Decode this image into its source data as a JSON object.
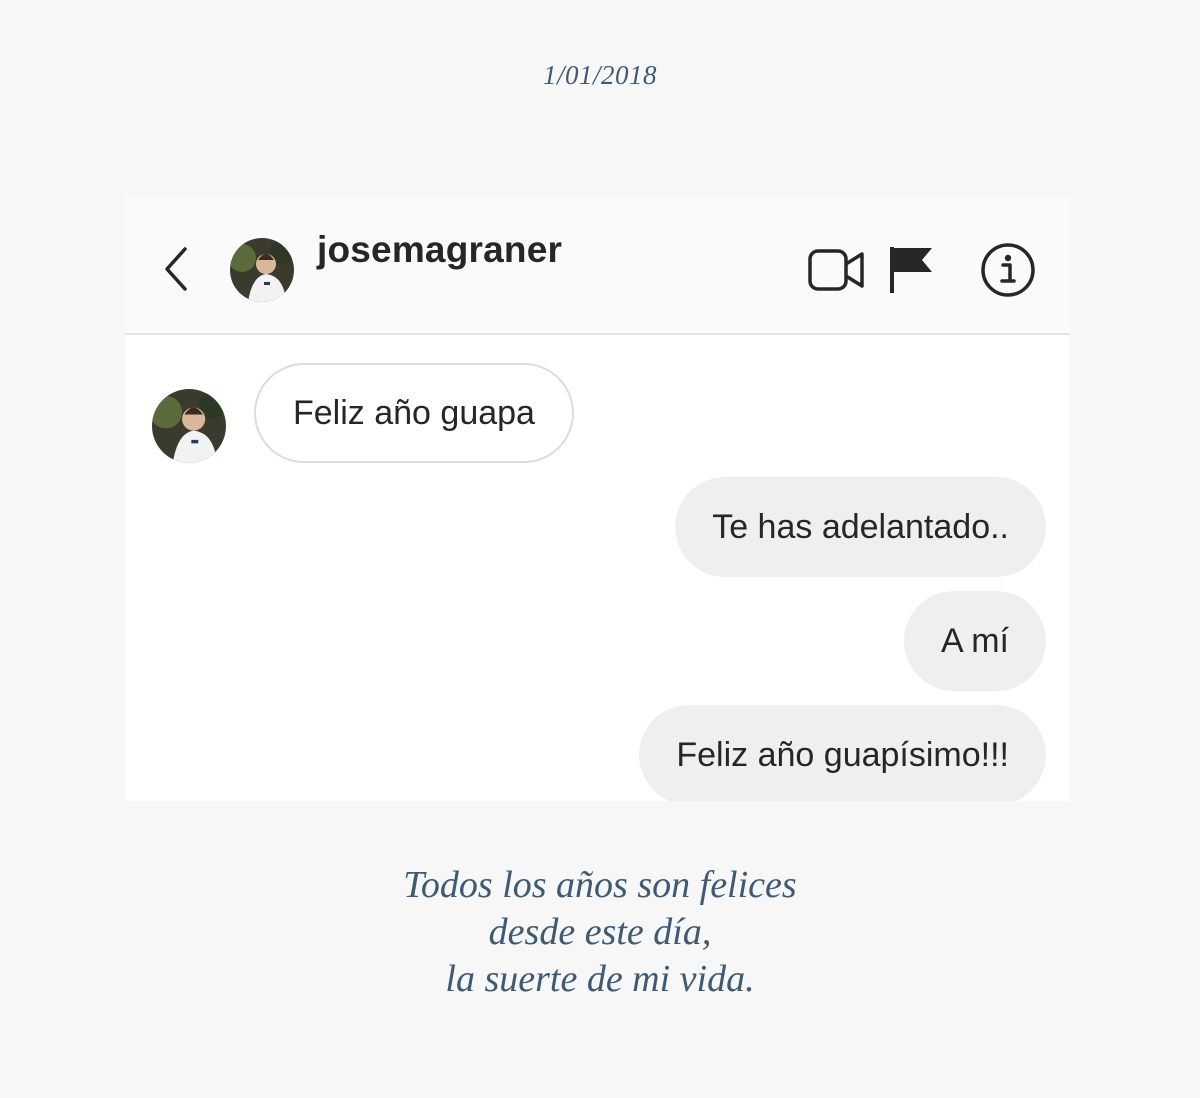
{
  "date": "1/01/2018",
  "header": {
    "back_icon": "chevron-left-icon",
    "username": "josemagraner",
    "actions": [
      "video-camera-icon",
      "flag-icon",
      "info-icon"
    ]
  },
  "thread": {
    "messages": [
      {
        "direction": "incoming",
        "text": "Feliz año guapa"
      },
      {
        "direction": "outgoing",
        "text": "Te has adelantado.."
      },
      {
        "direction": "outgoing",
        "text": "A mí"
      },
      {
        "direction": "outgoing",
        "text": "Feliz año guapísimo!!!"
      }
    ]
  },
  "caption": {
    "lines": [
      "Todos los años son felices",
      "desde este día,",
      "la suerte de mi vida."
    ]
  },
  "colors": {
    "caption_text": "#3e5a74",
    "outgoing_bubble": "#efefef",
    "incoming_border": "#dcdcdc",
    "header_bg": "#fafafa"
  }
}
